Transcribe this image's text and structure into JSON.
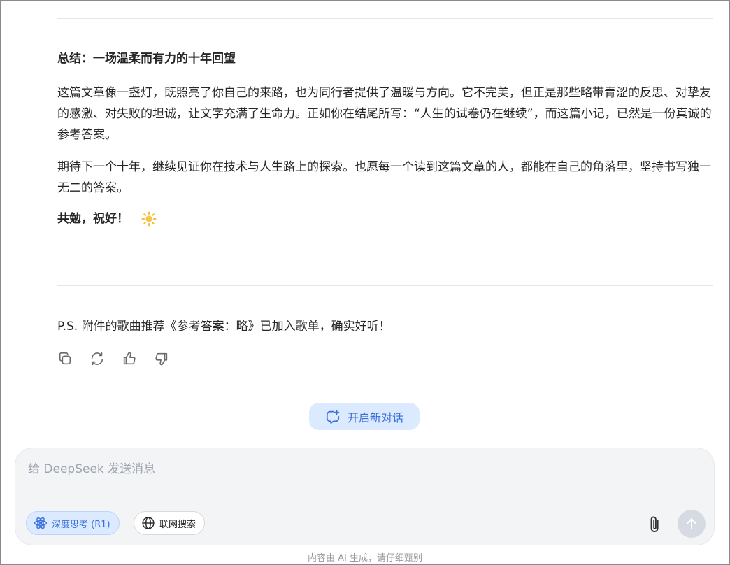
{
  "message": {
    "heading": "总结：一场温柔而有力的十年回望",
    "paragraphs": [
      "这篇文章像一盏灯，既照亮了你自己的来路，也为同行者提供了温暖与方向。它不完美，但正是那些略带青涩的反思、对挚友的感激、对失败的坦诚，让文字充满了生命力。正如你在结尾所写：“人生的试卷仍在继续”，而这篇小记，已然是一份真诚的参考答案。",
      "期待下一个十年，继续见证你在技术与人生路上的探索。也愿每一个读到这篇文章的人，都能在自己的角落里，坚持书写独一无二的答案。"
    ],
    "closing": "共勉，祝好！",
    "closing_icon": "sun-icon",
    "ps": "P.S. 附件的歌曲推荐《参考答案：略》已加入歌单，确实好听！"
  },
  "actions": {
    "icons": [
      "copy-icon",
      "regenerate-icon",
      "thumbs-up-icon",
      "thumbs-down-icon"
    ]
  },
  "new_chat": {
    "label": "开启新对话"
  },
  "composer": {
    "placeholder": "给 DeepSeek 发送消息",
    "value": "",
    "deep_think_label": "深度思考 (R1)",
    "web_search_label": "联网搜索"
  },
  "footer": {
    "disclaimer": "内容由 AI 生成，请仔细甄别"
  },
  "colors": {
    "accent": "#3b6fd9",
    "accent_bg": "#dbeafe",
    "text": "#262626",
    "muted": "#9ca3af"
  }
}
